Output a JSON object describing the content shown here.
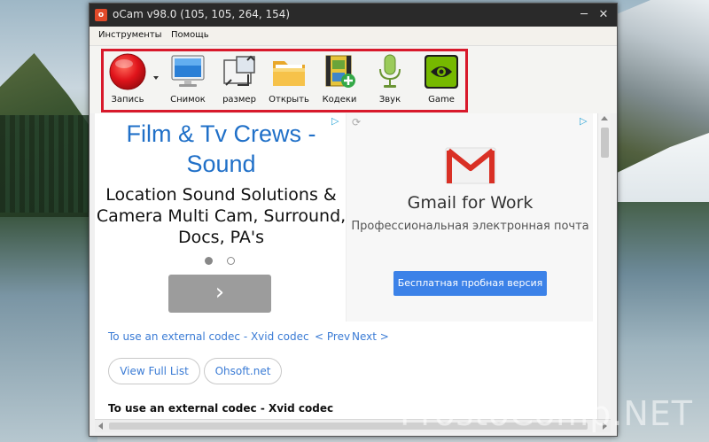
{
  "window": {
    "title": "oCam v98.0 (105, 105, 264, 154)",
    "minimize_glyph": "─",
    "close_glyph": "✕"
  },
  "menu": {
    "tools": "Инструменты",
    "help": "Помощь"
  },
  "toolbar": {
    "items": [
      {
        "label": "Запись",
        "icon": "record-icon"
      },
      {
        "label": "Снимок",
        "icon": "screenshot-icon"
      },
      {
        "label": "размер",
        "icon": "resize-icon"
      },
      {
        "label": "Открыть",
        "icon": "folder-icon"
      },
      {
        "label": "Кодеки",
        "icon": "codecs-icon"
      },
      {
        "label": "Звук",
        "icon": "microphone-icon"
      },
      {
        "label": "Game",
        "icon": "game-icon"
      }
    ],
    "highlight_color": "#d8192b"
  },
  "ad_left": {
    "title": "Film & Tv Crews - Sound",
    "description": "Location Sound Solutions & Camera Multi Cam, Surround, Docs, PA's",
    "go_glyph": "›"
  },
  "ad_right": {
    "title": "Gmail for Work",
    "subtitle": "Профессиональная электронная почта",
    "button": "Бесплатная пробная версия"
  },
  "links": {
    "codec_link": "To use an external codec - Xvid codec",
    "prev": "< Prev",
    "next": "Next >",
    "view_full_list": "View Full List",
    "site": "Ohsoft.net",
    "codec_heading": "To use an external codec - Xvid codec"
  },
  "watermark": "ProstoComp.NET",
  "colors": {
    "link": "#3a7bd5",
    "ad_title": "#2070c8",
    "gmail_button": "#3c82e8"
  }
}
